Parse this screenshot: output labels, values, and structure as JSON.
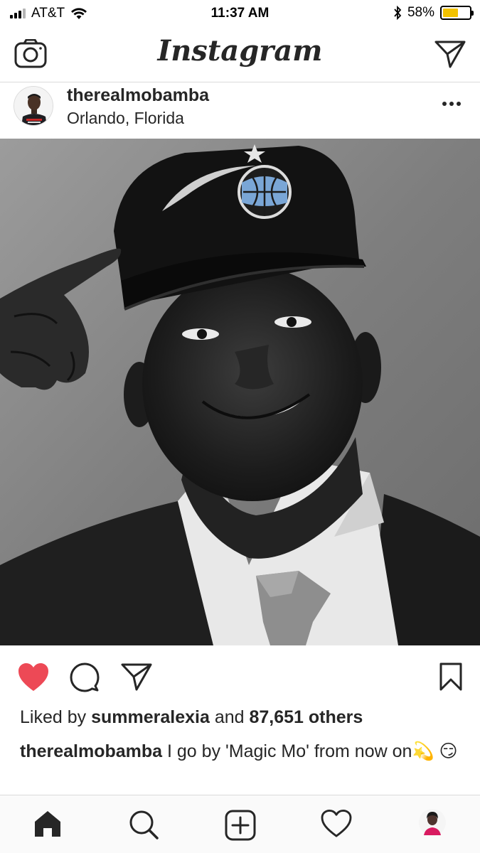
{
  "status_bar": {
    "carrier": "AT&T",
    "time": "11:37 AM",
    "battery_percent": "58%",
    "battery_level": 0.58,
    "battery_color": "#f2c200"
  },
  "header": {
    "app_title": "Instagram",
    "left_icon": "camera-icon",
    "right_icon": "direct-message-icon"
  },
  "post": {
    "username": "therealmobamba",
    "location": "Orlando, Florida",
    "more_icon": "more-options-icon",
    "image_icon": "post-photo",
    "actions": {
      "like_icon": "heart-filled-icon",
      "like_color": "#ed4956",
      "comment_icon": "comment-icon",
      "share_icon": "share-icon",
      "save_icon": "bookmark-icon"
    },
    "likes": {
      "prefix": "Liked by",
      "user": "summeralexia",
      "joiner": "and",
      "others": "87,651 others"
    },
    "caption": {
      "username": "therealmobamba",
      "text": "I go by 'Magic Mo' from now on",
      "emoji": "💫 😏"
    }
  },
  "tab_bar": {
    "items": [
      "home-icon",
      "search-icon",
      "new-post-icon",
      "activity-icon",
      "profile-icon"
    ]
  }
}
